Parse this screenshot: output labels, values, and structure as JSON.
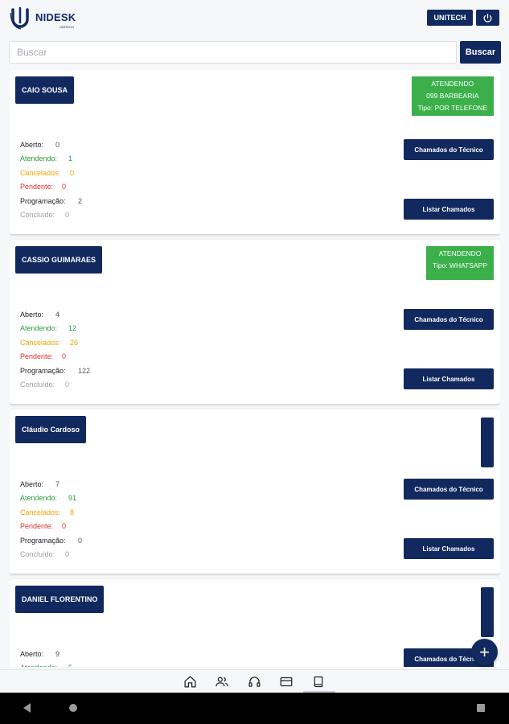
{
  "app": {
    "logo_text": "NIDESK",
    "logo_sub": "UNITECH",
    "user_button": "UNITECH"
  },
  "search": {
    "placeholder": "Buscar",
    "button": "Buscar"
  },
  "labels": {
    "aberto": "Aberto:",
    "atendendo": "Atendendo:",
    "cancelados": "Cancelados:",
    "pendente": "Pendente:",
    "programacao": "Programação:",
    "concluido": "Concluído:",
    "chamados_tecnico": "Chamados do Técnico",
    "listar_chamados": "Listar Chamados"
  },
  "cards": [
    {
      "name": "CAIO SOUSA",
      "status": [
        "ATENDENDO",
        "099 BARBEARIA",
        "Tipo: POR TELEFONE"
      ],
      "aberto": "0",
      "atendendo": "1",
      "cancelados": "0",
      "pendente": "0",
      "programacao": "2",
      "concluido": "0"
    },
    {
      "name": "CASSIO GUIMARAES",
      "status": [
        "ATENDENDO",
        "Tipo: WHATSAPP"
      ],
      "aberto": "4",
      "atendendo": "12",
      "cancelados": "26",
      "pendente": "0",
      "programacao": "122",
      "concluido": "0"
    },
    {
      "name": "Cláudio Cardoso",
      "status": [],
      "aberto": "7",
      "atendendo": "91",
      "cancelados": "8",
      "pendente": "0",
      "programacao": "0",
      "concluido": "0"
    },
    {
      "name": "DANIEL FLORENTINO",
      "status": [],
      "aberto": "9",
      "atendendo": "5",
      "cancelados": "",
      "pendente": "",
      "programacao": "",
      "concluido": ""
    }
  ],
  "fab": "+",
  "bottom_nav": [
    "home-icon",
    "users-icon",
    "headset-icon",
    "credit-card-icon",
    "book-icon"
  ],
  "colors": {
    "primary": "#12295f",
    "status_green": "#3bb04a",
    "atendendo": "#2a9b3a",
    "cancelados": "#f0a500",
    "pendente": "#d9302a",
    "concluido": "#9aa0a6"
  }
}
